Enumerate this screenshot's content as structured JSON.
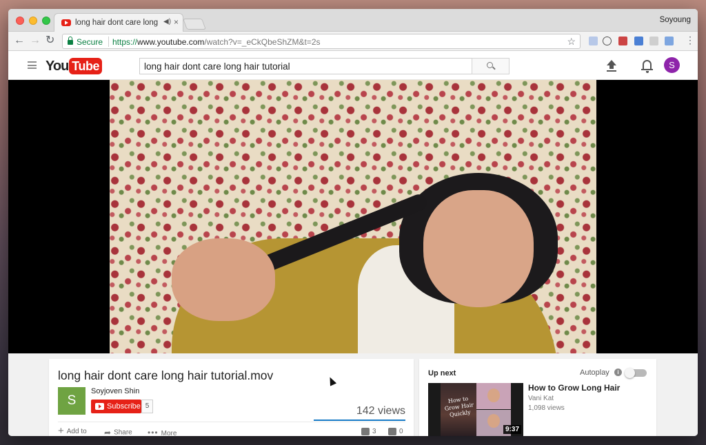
{
  "browser": {
    "tab_title": "long hair dont care long hair tutorial",
    "tab_close": "×",
    "tab_audio": "◀)",
    "user_name": "Soyoung",
    "secure_label": "Secure",
    "url_scheme": "https://",
    "url_domain": "www.youtube.com",
    "url_path": "/watch?v=_eCkQbeShZM&t=2s",
    "back": "←",
    "forward": "→",
    "reload": "↻",
    "star": "☆",
    "menu": "⋮"
  },
  "youtube": {
    "logo_you": "You",
    "logo_tube": "Tube",
    "search_value": "long hair dont care long hair tutorial",
    "avatar_letter": "S"
  },
  "video": {
    "title": "long hair dont care long hair tutorial.mov",
    "channel_avatar": "S",
    "channel_name": "Soyjoven Shin",
    "subscribe_label": "Subscribe",
    "subscriber_count": "5",
    "views": "142 views",
    "add_to": "Add to",
    "share": "Share",
    "more": "More",
    "likes": "3",
    "dislikes": "0"
  },
  "sidebar": {
    "up_next": "Up next",
    "autoplay": "Autoplay",
    "autoplay_on": false,
    "recommendation": {
      "title": "How to Grow Long Hair",
      "channel": "Vani Kat",
      "views": "1,098 views",
      "duration": "9:37",
      "thumb_text": "How to Grow Hair Quickly"
    }
  },
  "colors": {
    "youtube_red": "#e62117",
    "secure_green": "#0b8043",
    "avatar_purple": "#8e24aa",
    "channel_green": "#6fa342"
  }
}
